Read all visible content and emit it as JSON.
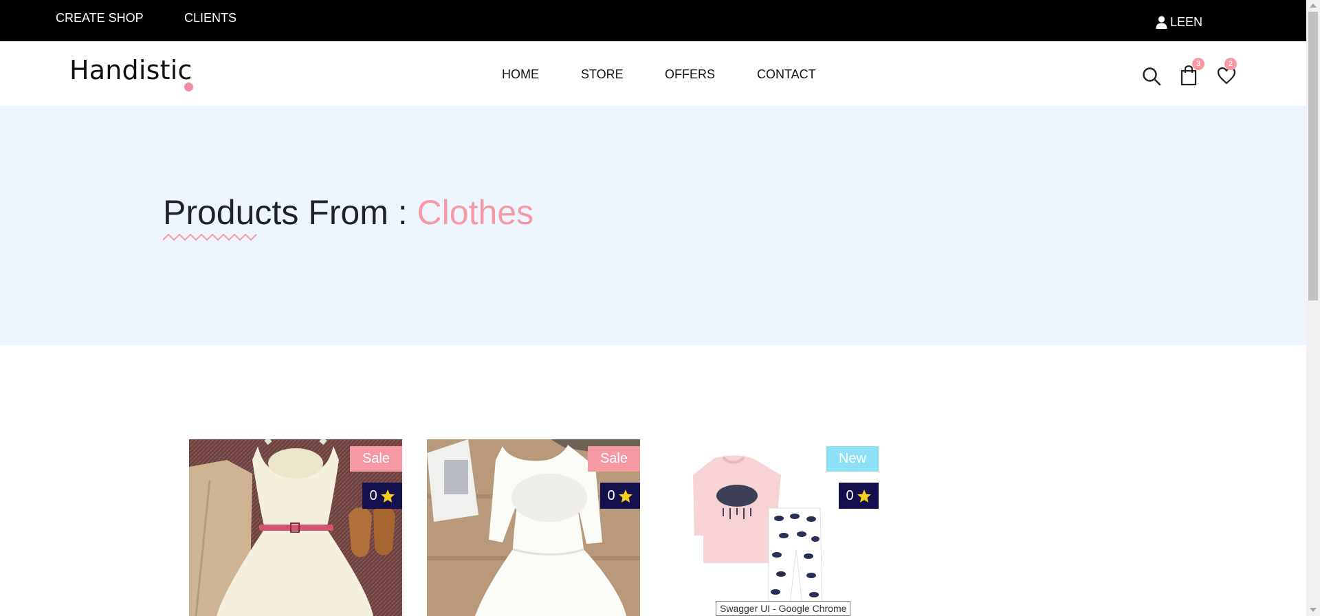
{
  "topbar": {
    "links": [
      "CREATE SHOP",
      "CLIENTS"
    ],
    "user_label": "LEEN",
    "user_icon": "user-icon"
  },
  "header": {
    "logo": "Handistic",
    "nav": [
      "HOME",
      "STORE",
      "OFFERS",
      "CONTACT"
    ],
    "icons": [
      "search-icon",
      "shopping-bag-icon",
      "heart-icon"
    ],
    "cart_count": "3",
    "wishlist_count": "2"
  },
  "hero": {
    "title_prefix": "Products From :",
    "category": "Clothes",
    "accent_color": "#f59aa5"
  },
  "products": [
    {
      "tag": "Sale",
      "rating": "0",
      "tag_color": "#f59aa5",
      "image": "cream dress with belt, cardigan and brown shoes"
    },
    {
      "tag": "Sale",
      "rating": "0",
      "tag_color": "#f59aa5",
      "image": "white lace tulle girls dress"
    },
    {
      "tag": "New",
      "rating": "0",
      "tag_color": "#8ee0f7",
      "image": "pink kids pajama set with cloud print"
    }
  ],
  "tooltip": "Swagger UI - Google Chrome",
  "colors": {
    "topbar": "#000000",
    "hero_bg": "#eef5ff",
    "rating_bg": "#14104e",
    "star": "#f5cf1b"
  }
}
